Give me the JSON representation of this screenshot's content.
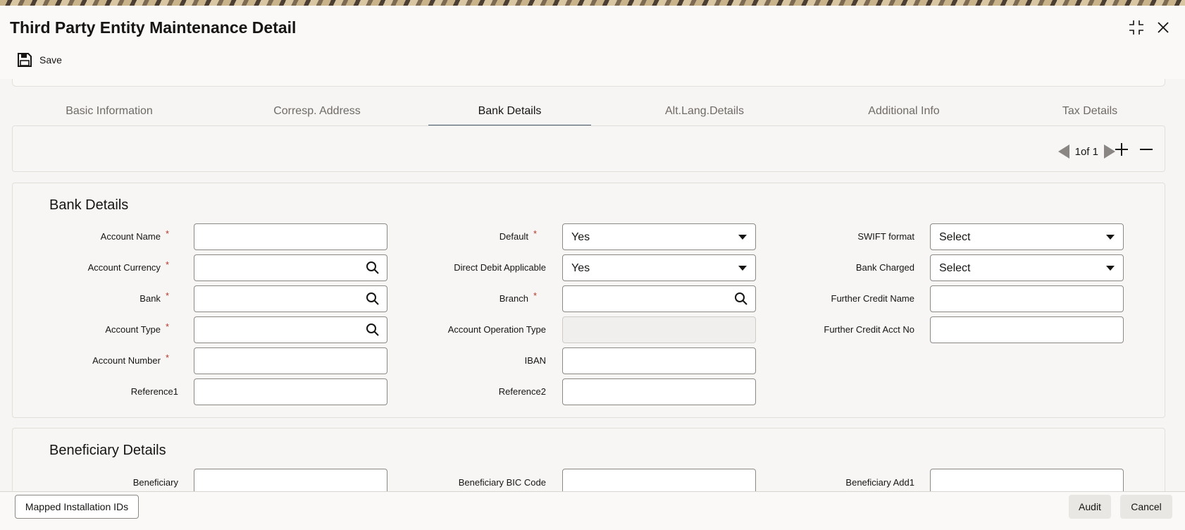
{
  "window": {
    "title": "Third Party Entity Maintenance Detail"
  },
  "toolbar": {
    "save_label": "Save"
  },
  "tabs": [
    {
      "label": "Basic Information"
    },
    {
      "label": "Corresp. Address"
    },
    {
      "label": "Bank Details",
      "active": true
    },
    {
      "label": "Alt.Lang.Details"
    },
    {
      "label": "Additional Info"
    },
    {
      "label": "Tax Details"
    }
  ],
  "pager": {
    "text": "1of 1",
    "current": 1,
    "total": 1
  },
  "bank_details": {
    "title": "Bank Details",
    "account_name": {
      "label": "Account Name",
      "value": ""
    },
    "account_currency": {
      "label": "Account Currency",
      "value": ""
    },
    "bank": {
      "label": "Bank",
      "value": ""
    },
    "account_type": {
      "label": "Account Type",
      "value": ""
    },
    "account_number": {
      "label": "Account Number",
      "value": ""
    },
    "reference1": {
      "label": "Reference1",
      "value": ""
    },
    "default": {
      "label": "Default",
      "value": "Yes"
    },
    "direct_debit": {
      "label": "Direct Debit Applicable",
      "value": "Yes"
    },
    "branch": {
      "label": "Branch",
      "value": ""
    },
    "account_operation_type": {
      "label": "Account Operation Type",
      "value": ""
    },
    "iban": {
      "label": "IBAN",
      "value": ""
    },
    "reference2": {
      "label": "Reference2",
      "value": ""
    },
    "swift_format": {
      "label": "SWIFT format",
      "value": "Select"
    },
    "bank_charged": {
      "label": "Bank Charged",
      "value": "Select"
    },
    "further_credit_name": {
      "label": "Further Credit Name",
      "value": ""
    },
    "further_credit_acct": {
      "label": "Further Credit Acct No",
      "value": ""
    }
  },
  "beneficiary_details": {
    "title": "Beneficiary Details",
    "beneficiary": {
      "label": "Beneficiary",
      "value": ""
    },
    "bic_code": {
      "label": "Beneficiary BIC Code",
      "value": ""
    },
    "add1": {
      "label": "Beneficiary Add1",
      "value": ""
    }
  },
  "footer": {
    "mapped_label": "Mapped Installation IDs",
    "audit_label": "Audit",
    "cancel_label": "Cancel"
  }
}
